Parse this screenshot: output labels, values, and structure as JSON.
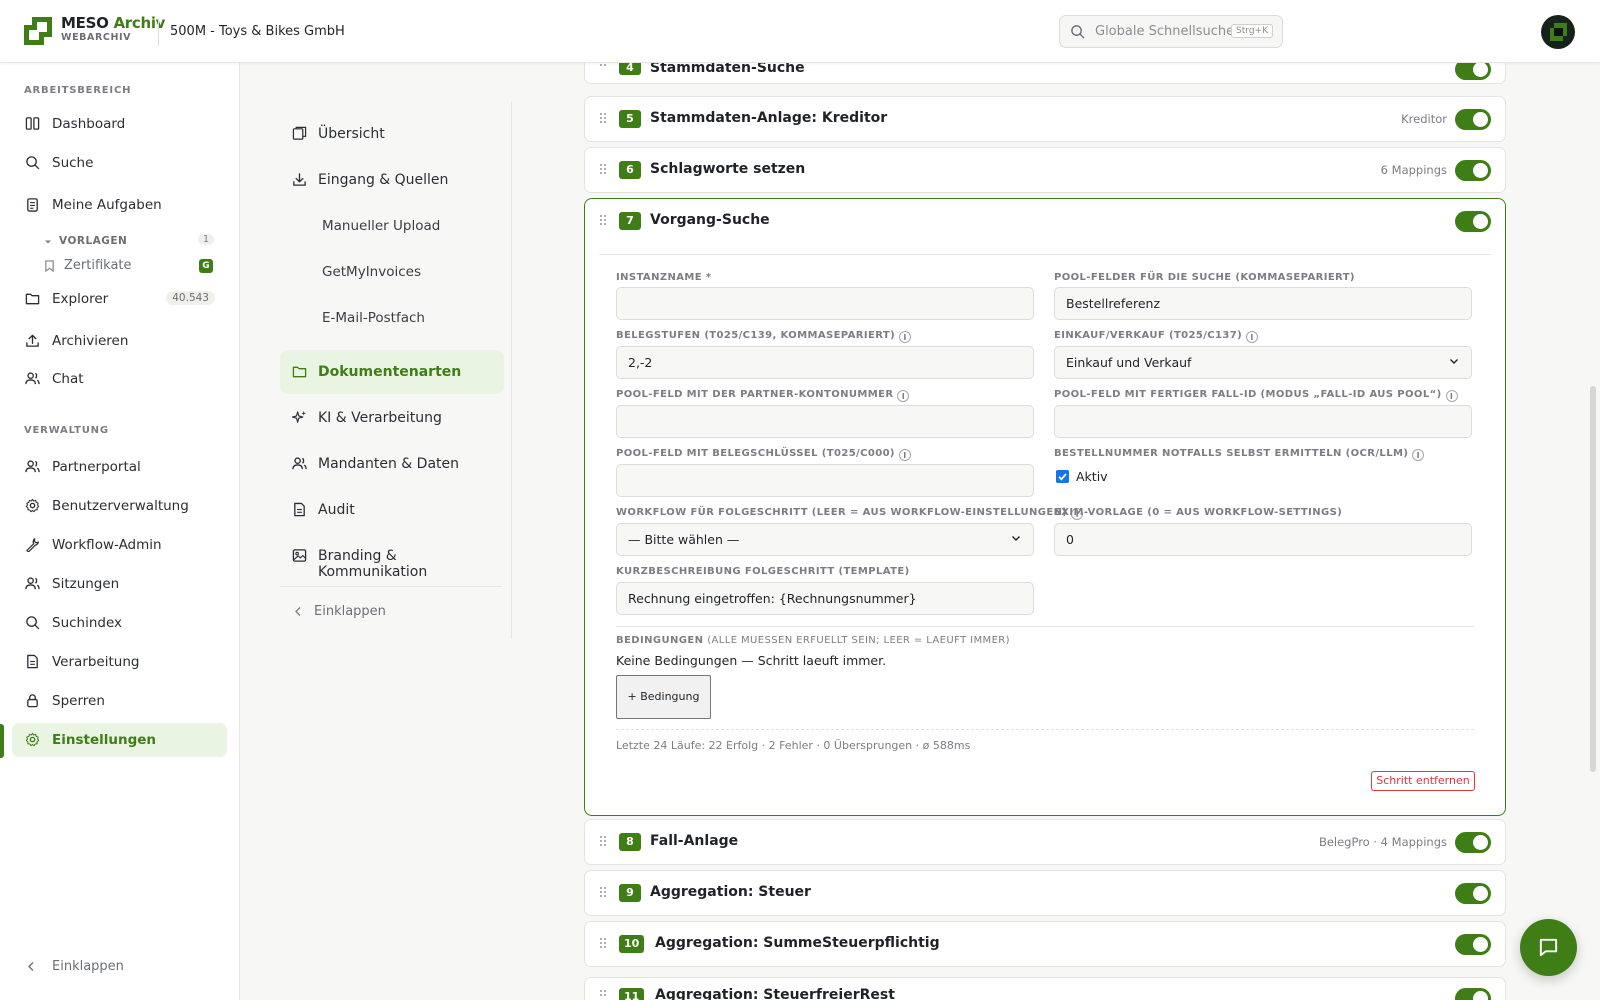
{
  "header": {
    "brand_name": "MESO",
    "brand_accent": "Archiv",
    "brand_sub": "WEBARCHIV",
    "tenant": "500M - Toys & Bikes GmbH",
    "search_placeholder": "Globale Schnellsuche",
    "search_shortcut": "Strg+K"
  },
  "sidebar": {
    "section_workspace": "ARBEITSBEREICH",
    "section_admin": "VERWALTUNG",
    "items": {
      "dashboard": "Dashboard",
      "suche": "Suche",
      "aufgaben": "Meine Aufgaben",
      "vorlagen": "VORLAGEN",
      "vorlagen_count": "1",
      "zertifikate": "Zertifikate",
      "zertifikate_badge": "G",
      "explorer": "Explorer",
      "explorer_count": "40.543",
      "archivieren": "Archivieren",
      "chat": "Chat",
      "partnerportal": "Partnerportal",
      "benutzer": "Benutzerverwaltung",
      "workflow_admin": "Workflow-Admin",
      "sitzungen": "Sitzungen",
      "suchindex": "Suchindex",
      "verarbeitung": "Verarbeitung",
      "sperren": "Sperren",
      "einstellungen": "Einstellungen"
    },
    "collapse": "Einklappen"
  },
  "settings_nav": {
    "uebersicht": "Übersicht",
    "eingang": "Eingang & Quellen",
    "upload": "Manueller Upload",
    "getmyinvoices": "GetMyInvoices",
    "email": "E-Mail-Postfach",
    "dokumentenarten": "Dokumentenarten",
    "ki": "KI & Verarbeitung",
    "mandanten": "Mandanten & Daten",
    "audit": "Audit",
    "branding": "Branding & Kommunikation",
    "collapse": "Einklappen"
  },
  "steps": {
    "s4": {
      "num": "4",
      "title": "Stammdaten-Suche",
      "meta": ""
    },
    "s5": {
      "num": "5",
      "title": "Stammdaten-Anlage: Kreditor",
      "meta": "Kreditor"
    },
    "s6": {
      "num": "6",
      "title": "Schlagworte setzen",
      "meta": "6 Mappings"
    },
    "s7": {
      "num": "7",
      "title": "Vorgang-Suche"
    },
    "s8": {
      "num": "8",
      "title": "Fall-Anlage",
      "meta": "BelegPro · 4 Mappings"
    },
    "s9": {
      "num": "9",
      "title": "Aggregation: Steuer",
      "meta": ""
    },
    "s10": {
      "num": "10",
      "title": "Aggregation: SummeSteuerpflichtig",
      "meta": ""
    },
    "s11": {
      "num": "11",
      "title": "Aggregation: SteuerfreierRest",
      "meta": ""
    }
  },
  "form": {
    "instanzname_label": "INSTANZNAME *",
    "instanzname_value": "",
    "pool_felder_label": "POOL-FELDER FÜR DIE SUCHE (KOMMASEPARIERT)",
    "pool_felder_value": "Bestellreferenz",
    "belegstufen_label": "BELEGSTUFEN (T025/C139, KOMMASEPARIERT)",
    "belegstufen_value": "2,-2",
    "einkauf_label": "EINKAUF/VERKAUF (T025/C137)",
    "einkauf_value": "Einkauf und Verkauf",
    "partner_label": "POOL-FELD MIT DER PARTNER-KONTONUMMER",
    "partner_value": "",
    "fall_id_label": "POOL-FELD MIT FERTIGER FALL-ID (MODUS „FALL-ID AUS POOL“)",
    "fall_id_value": "",
    "belegschluessel_label": "POOL-FELD MIT BELEGSCHLÜSSEL (T025/C000)",
    "belegschluessel_value": "",
    "bestellnummer_label": "BESTELLNUMMER NOTFALLS SELBST ERMITTELN (OCR/LLM)",
    "aktiv_label": "Aktiv",
    "workflow_label": "WORKFLOW FÜR FOLGESCHRITT (LEER = AUS WORKFLOW-EINSTELLUNGEN)",
    "workflow_value": "— Bitte wählen —",
    "exim_label": "EXIM-VORLAGE (0 = AUS WORKFLOW-SETTINGS)",
    "exim_value": "0",
    "kurz_label": "KURZBESCHREIBUNG FOLGESCHRITT (TEMPLATE)",
    "kurz_value": "Rechnung eingetroffen: {Rechnungsnummer}",
    "bedingungen_label": "BEDINGUNGEN",
    "bedingungen_hint": "(ALLE MUESSEN ERFUELLT SEIN; LEER = LAEUFT IMMER)",
    "bedingungen_text": "Keine Bedingungen — Schritt laeuft immer.",
    "add_condition": "+ Bedingung",
    "runs": "Letzte 24 Läufe: 22 Erfolg · 2 Fehler · 0 Übersprungen · ø 588ms",
    "remove": "Schritt entfernen"
  },
  "colors": {
    "accent": "#3f7d16",
    "accent_bg": "#eaf4e2",
    "danger": "#d9363e"
  }
}
